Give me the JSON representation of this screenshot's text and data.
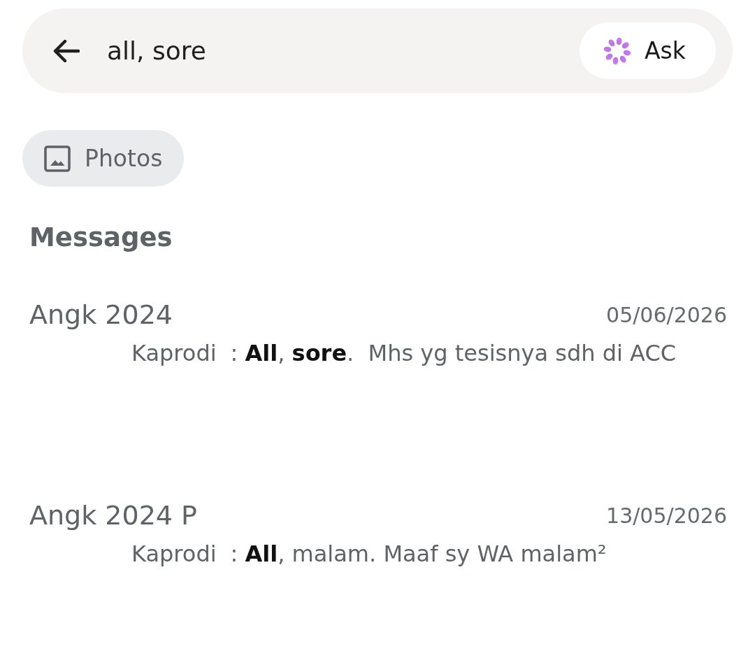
{
  "search_bar": {
    "query": "all, sore",
    "ask_button": {
      "label": "Ask"
    }
  },
  "filter_chips": [
    {
      "label": "Photos"
    }
  ],
  "messages": {
    "heading": "Messages",
    "results": [
      {
        "title": "Angk 2024",
        "date": "05/06/2026",
        "sender": "Kaprodi",
        "preview": ": **All**, **sore**.  Mhs yg tesisnya sdh di ACC"
      },
      {
        "title": "Angk 2024 P",
        "date": "13/05/2026",
        "sender": "Kaprodi",
        "preview": ": **All**, malam. Maaf sy WA malam²"
      }
    ]
  }
}
